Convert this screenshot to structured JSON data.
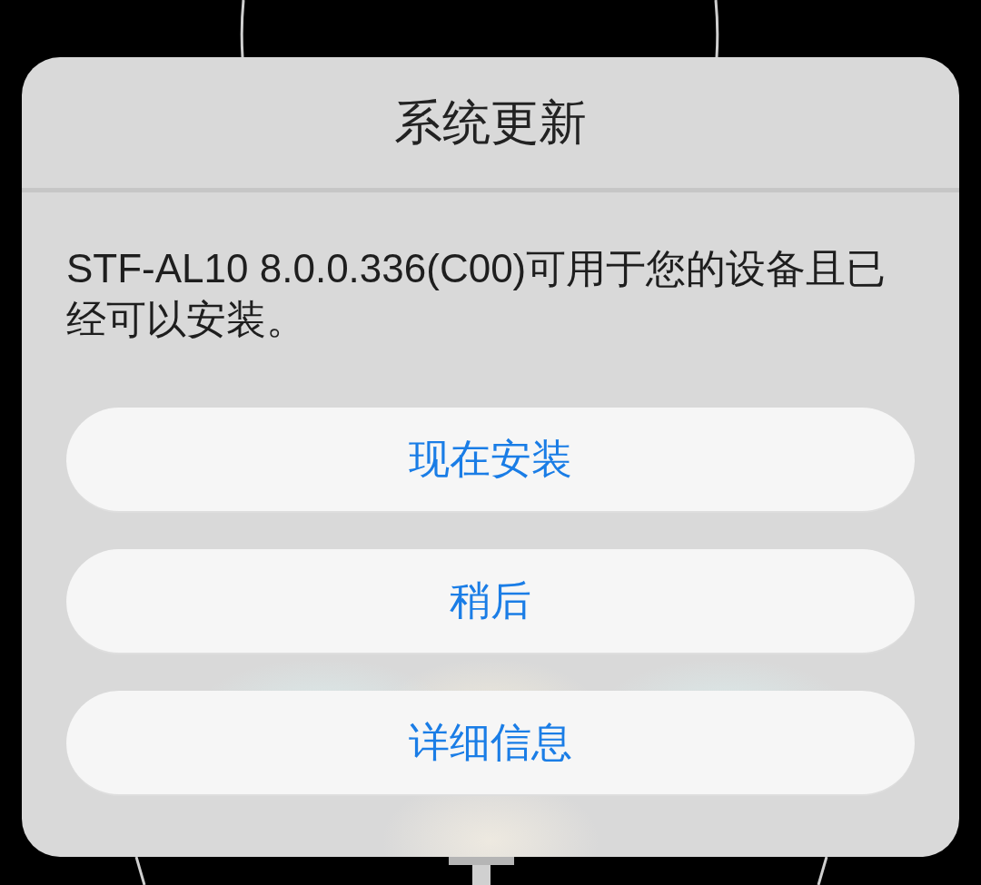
{
  "dialog": {
    "title": "系统更新",
    "message": "STF-AL10 8.0.0.336(C00)可用于您的设备且已经可以安装。",
    "buttons": [
      {
        "label": "现在安装"
      },
      {
        "label": "稍后"
      },
      {
        "label": "详细信息"
      }
    ]
  }
}
